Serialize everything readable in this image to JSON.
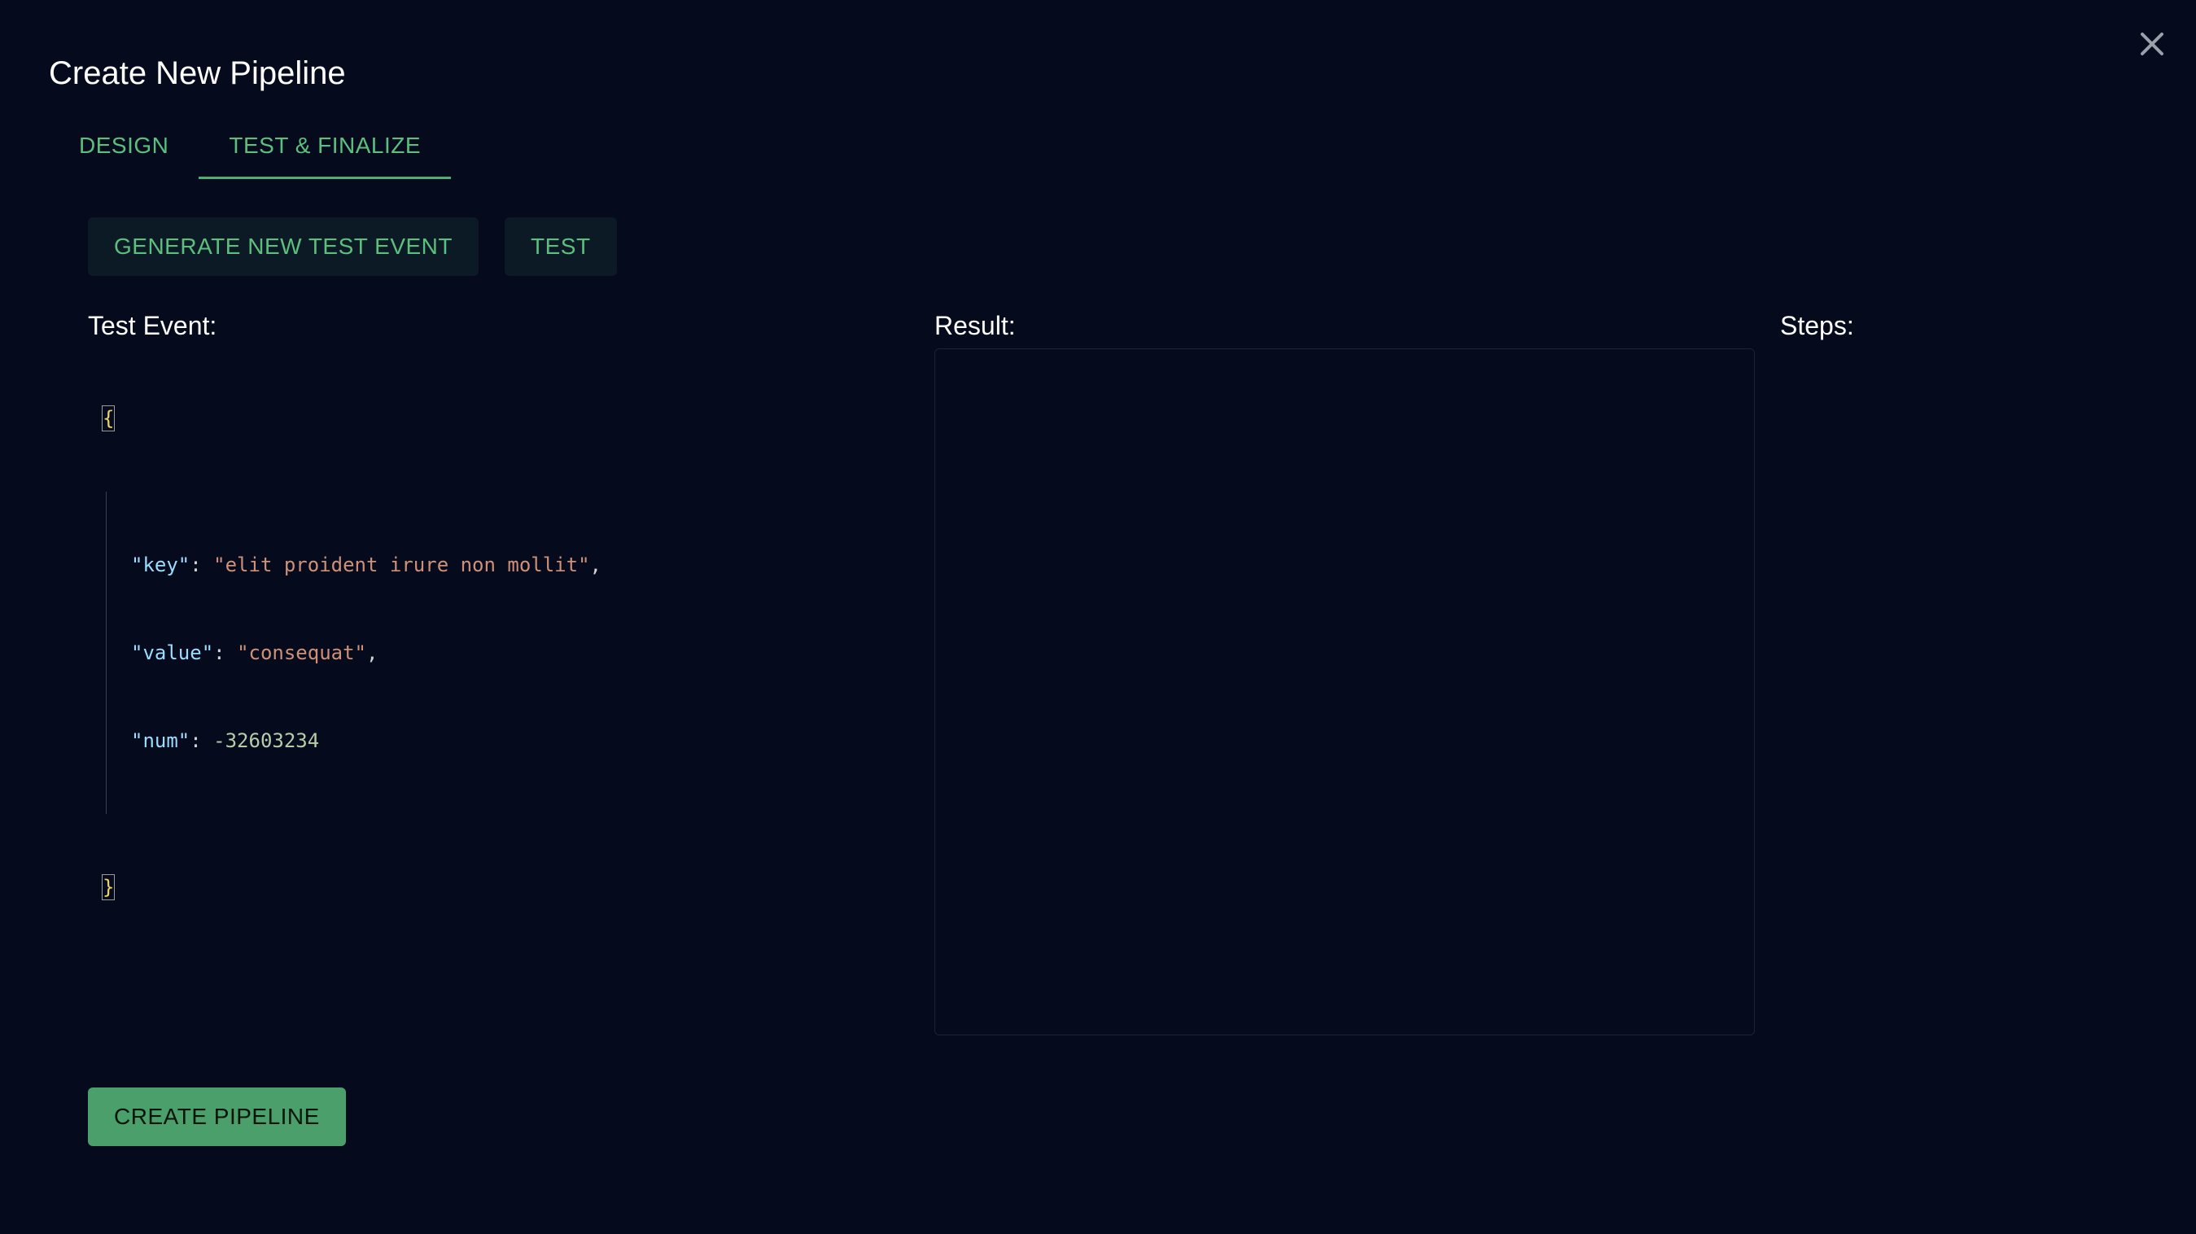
{
  "dialog": {
    "title": "Create New Pipeline",
    "close_icon": "close-icon"
  },
  "tabs": [
    {
      "label": "DESIGN",
      "active": false
    },
    {
      "label": "TEST & FINALIZE",
      "active": true
    }
  ],
  "actions": {
    "generate_label": "GENERATE NEW TEST EVENT",
    "test_label": "TEST",
    "create_label": "CREATE PIPELINE"
  },
  "sections": {
    "test_event_label": "Test Event:",
    "result_label": "Result:",
    "steps_label": "Steps:"
  },
  "test_event": {
    "open_brace": "{",
    "close_brace": "}",
    "fields": [
      {
        "key": "\"key\"",
        "value": "\"elit proident irure non mollit\"",
        "type": "string",
        "trailing": ","
      },
      {
        "key": "\"value\"",
        "value": "\"consequat\"",
        "type": "string",
        "trailing": ","
      },
      {
        "key": "\"num\"",
        "value": "-32603234",
        "type": "number",
        "trailing": ""
      }
    ]
  },
  "colors": {
    "background": "#050a1c",
    "accent": "#5cbf7d",
    "primary_button": "#4a9f6a",
    "secondary_button": "#0b1a24"
  }
}
